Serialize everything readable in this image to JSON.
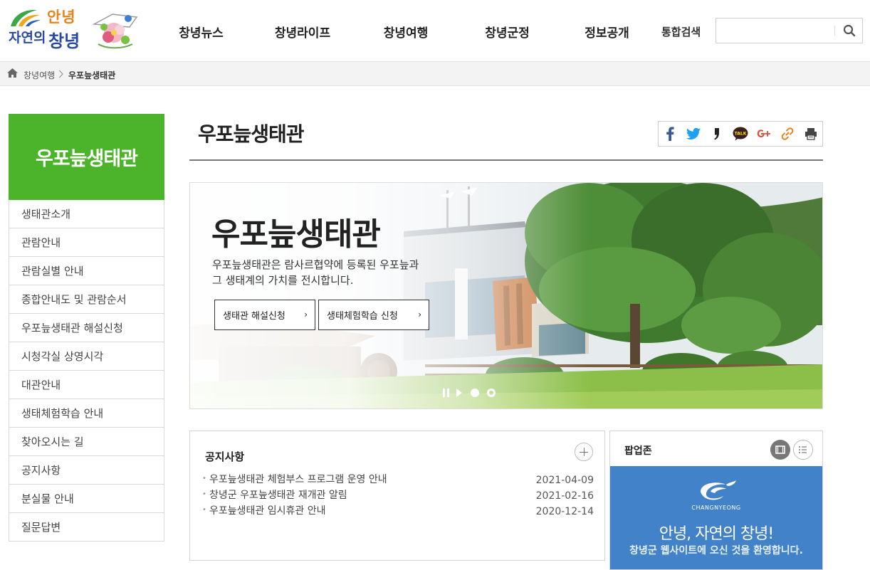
{
  "header": {
    "logo": {
      "line1": "안녕",
      "line2a": "자연의",
      "line2b": "창녕"
    },
    "nav": [
      {
        "label": "창녕뉴스",
        "width": 145
      },
      {
        "label": "창녕라이프",
        "width": 140
      },
      {
        "label": "창녕여행",
        "width": 150
      },
      {
        "label": "창녕군정",
        "width": 135
      },
      {
        "label": "정보공개",
        "width": 145
      }
    ],
    "search_label": "통합검색",
    "search": {
      "value": "",
      "placeholder": ""
    }
  },
  "breadcrumb": {
    "items": [
      "창녕여행",
      "우포늪생태관"
    ]
  },
  "sidebar": {
    "title": "우포늪생태관",
    "items": [
      {
        "label": "생태관소개"
      },
      {
        "label": "관람안내"
      },
      {
        "label": "관람실별 안내"
      },
      {
        "label": "종합안내도 및 관람순서"
      },
      {
        "label": "우포늪생태관 해설신청"
      },
      {
        "label": "시청각실 상영시각"
      },
      {
        "label": "대관안내"
      },
      {
        "label": "생태체험학습 안내"
      },
      {
        "label": "찾아오시는 길"
      },
      {
        "label": "공지사항"
      },
      {
        "label": "분실물 안내"
      },
      {
        "label": "질문답변"
      }
    ]
  },
  "content": {
    "page_title": "우포늪생태관",
    "share_icons": [
      "facebook-icon",
      "twitter-icon",
      "blog-icon",
      "kakaotalk-icon",
      "google-plus-icon",
      "link-icon",
      "print-icon"
    ],
    "kakao_label": "TALK",
    "hero": {
      "title": "우포늪생태관",
      "desc_line1": "우포늪생태관은 람사르협약에 등록된 우포늪과",
      "desc_line2": "그 생태계의 가치를 전시합니다.",
      "btn1": "생태관 해설신청",
      "btn2": "생태체험학습 신청",
      "chevron": "›"
    },
    "notice": {
      "title": "공지사항",
      "rows": [
        {
          "title": "우포늪생태관 체험부스 프로그램 운영 안내",
          "date": "2021-04-09"
        },
        {
          "title": "창녕군 우포늪생태관 재개관 알림",
          "date": "2021-02-16"
        },
        {
          "title": "우포늪생태관 임시휴관 안내",
          "date": "2020-12-14"
        }
      ]
    },
    "popup": {
      "title": "팝업존",
      "banner_logo_text": "CHANGNYEONG",
      "banner_heading": "안녕, 자연의 창녕!",
      "banner_sub": "창녕군 웹사이트에 오신 것을 환영합니다."
    }
  },
  "colors": {
    "accent_green": "#4cb42b",
    "popup_blue": "#4182c8",
    "logo_orange": "#e8841b",
    "logo_blue": "#2a4aa0"
  }
}
